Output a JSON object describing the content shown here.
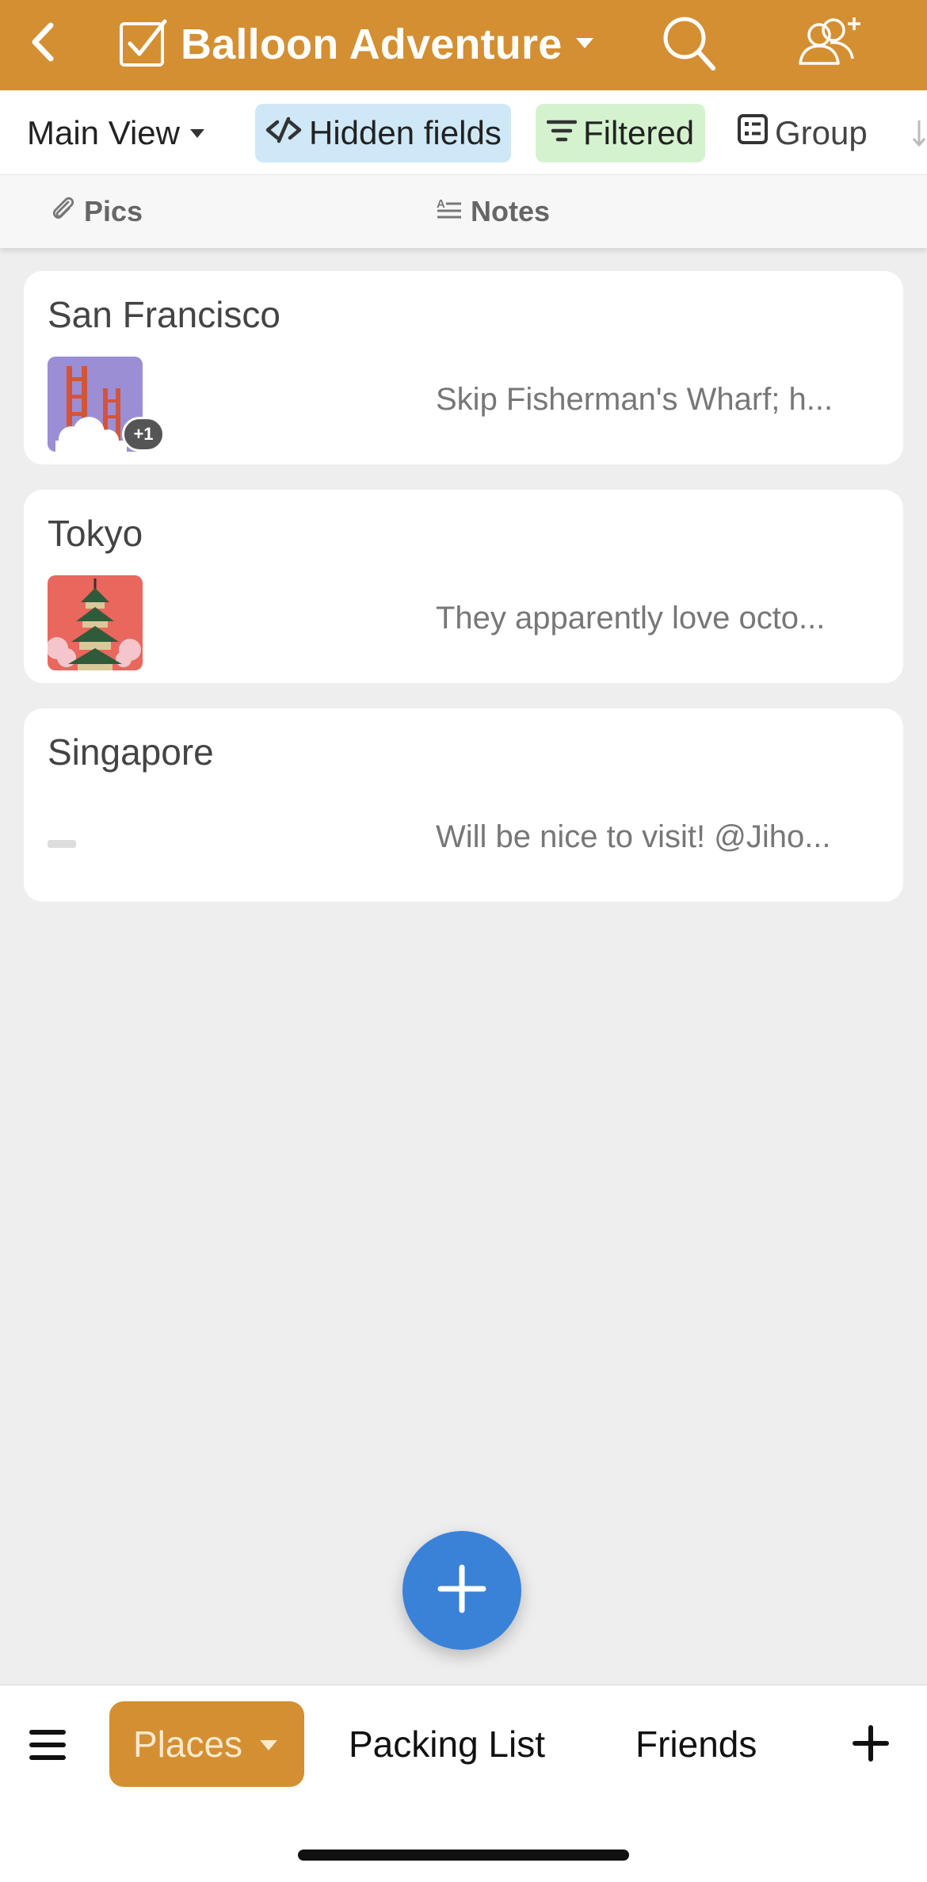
{
  "header": {
    "title": "Balloon Adventure",
    "bg_color": "#d38f32"
  },
  "toolbar": {
    "view_name": "Main View",
    "hidden_fields": "Hidden fields",
    "filtered": "Filtered",
    "group": "Group"
  },
  "columns": {
    "pics": "Pics",
    "notes": "Notes"
  },
  "records": [
    {
      "name": "San Francisco",
      "note": "Skip Fisherman's Wharf; h...",
      "extra_count": "+1"
    },
    {
      "name": "Tokyo",
      "note": "They apparently love octo..."
    },
    {
      "name": "Singapore",
      "note": "Will be nice to visit! @Jiho..."
    }
  ],
  "tabs": {
    "active": "Places",
    "packing": "Packing List",
    "friends": "Friends"
  },
  "colors": {
    "accent": "#d38f32",
    "fab": "#3a82d8",
    "hidden_chip": "#cfe8f7",
    "filtered_chip": "#d5f2cf"
  }
}
